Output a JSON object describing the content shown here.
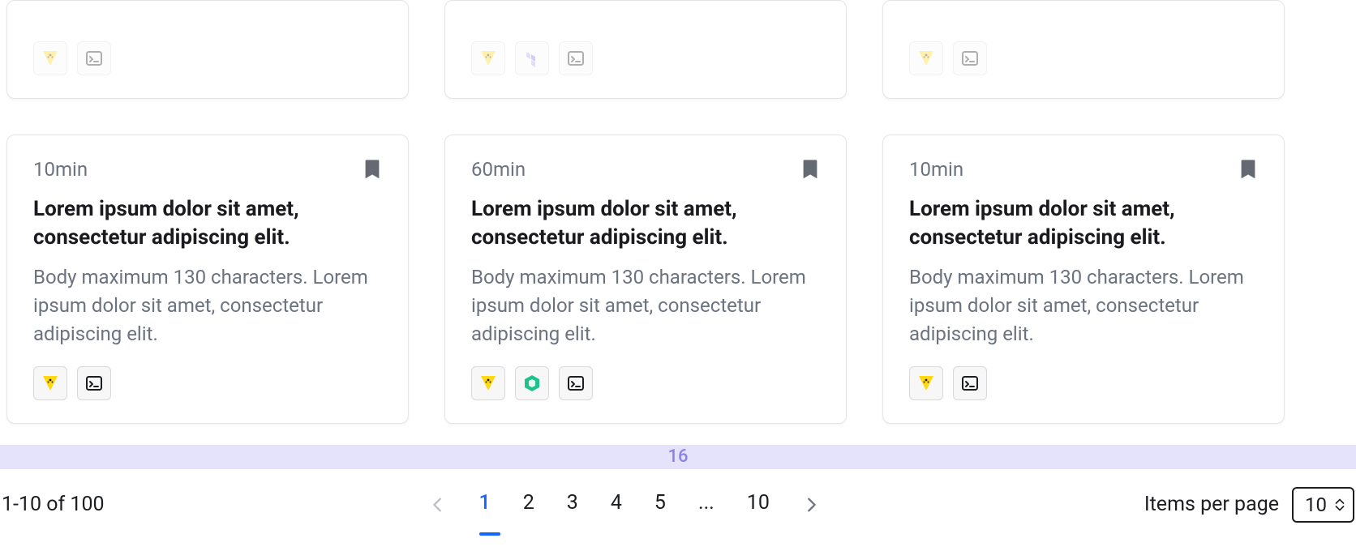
{
  "strip_label": "16",
  "row1": {
    "cards": [
      {
        "badges": [
          "vault",
          "terminal"
        ]
      },
      {
        "badges": [
          "vault",
          "terraform",
          "terminal"
        ]
      },
      {
        "badges": [
          "vault",
          "terminal"
        ]
      }
    ],
    "faded": true
  },
  "row2": {
    "cards": [
      {
        "duration": "10min",
        "title": "Lorem ipsum dolor sit amet, consectetur adipiscing elit.",
        "body": "Body maximum 130 characters. Lorem ipsum dolor sit amet, consectetur adipiscing elit.",
        "badges": [
          "vault",
          "terminal"
        ]
      },
      {
        "duration": "60min",
        "title": "Lorem ipsum dolor sit amet, consectetur adipiscing elit.",
        "body": "Body maximum 130 characters. Lorem ipsum dolor sit amet, consectetur adipiscing elit.",
        "badges": [
          "vault",
          "nomad",
          "terminal"
        ]
      },
      {
        "duration": "10min",
        "title": "Lorem ipsum dolor sit amet, consectetur adipiscing elit.",
        "body": "Body maximum 130 characters. Lorem ipsum dolor sit amet, consectetur adipiscing elit.",
        "badges": [
          "vault",
          "terminal"
        ]
      }
    ]
  },
  "pagination": {
    "status": "1-10 of 100",
    "pages": [
      "1",
      "2",
      "3",
      "4",
      "5",
      "...",
      "10"
    ],
    "active_index": 0,
    "per_page_label": "Items per page",
    "per_page_value": "10"
  }
}
